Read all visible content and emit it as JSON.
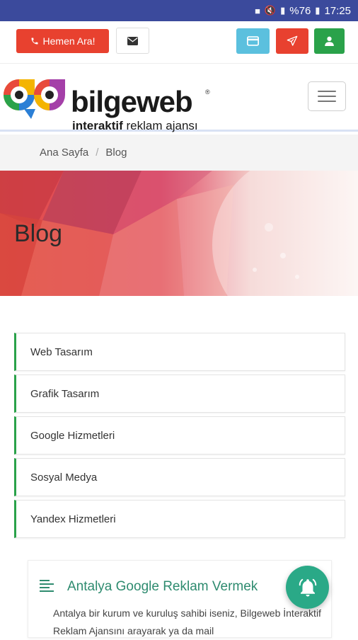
{
  "statusbar": {
    "battery": "%76",
    "time": "17:25"
  },
  "topbar": {
    "call_label": "Hemen Ara!"
  },
  "logo": {
    "name": "bilgeweb",
    "tagline_bold": "interaktif",
    "tagline_rest": " reklam ajansı"
  },
  "breadcrumb": {
    "home": "Ana Sayfa",
    "separator": "/",
    "current": "Blog"
  },
  "hero": {
    "title": "Blog"
  },
  "categories": [
    {
      "label": "Web Tasarım"
    },
    {
      "label": "Grafik Tasarım"
    },
    {
      "label": "Google Hizmetleri"
    },
    {
      "label": "Sosyal Medya"
    },
    {
      "label": "Yandex Hizmetleri"
    }
  ],
  "post": {
    "title": "Antalya Google Reklam Vermek",
    "excerpt": "Antalya bir kurum ve kuruluş sahibi iseniz, Bilgeweb İnteraktif Reklam Ajansını arayarak ya da mail"
  },
  "colors": {
    "accent_green": "#2aa24a",
    "accent_red": "#e8412f",
    "accent_blue": "#5bc0de",
    "statusbar": "#3b4a9c",
    "teal": "#2aa987"
  }
}
